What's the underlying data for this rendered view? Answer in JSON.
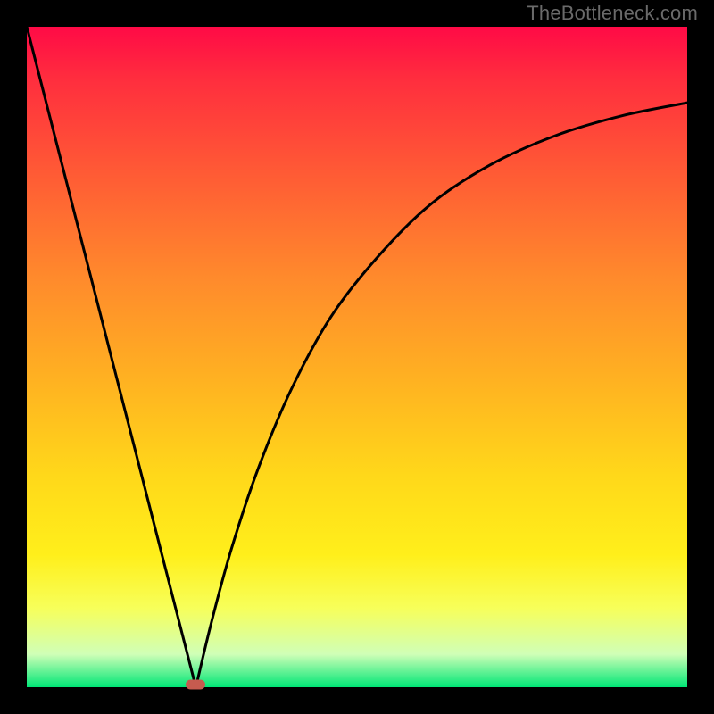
{
  "watermark": "TheBottleneck.com",
  "chart_data": {
    "type": "line",
    "title": "",
    "xlabel": "",
    "ylabel": "",
    "xlim": [
      0,
      100
    ],
    "ylim": [
      0,
      100
    ],
    "grid": false,
    "legend": false,
    "background_gradient": {
      "direction": "vertical",
      "stops": [
        {
          "pct": 0,
          "color": "#ff0a46"
        },
        {
          "pct": 22,
          "color": "#ff5a35"
        },
        {
          "pct": 54,
          "color": "#ffb321"
        },
        {
          "pct": 80,
          "color": "#ffef1b"
        },
        {
          "pct": 95,
          "color": "#d0ffb7"
        },
        {
          "pct": 100,
          "color": "#00e676"
        }
      ]
    },
    "series": [
      {
        "name": "left-slope",
        "x": [
          0,
          25.6
        ],
        "y": [
          100,
          0
        ],
        "stroke": "#000000"
      },
      {
        "name": "right-curve",
        "x": [
          25.6,
          28,
          31,
          35,
          40,
          46,
          53,
          61,
          70,
          80,
          90,
          100
        ],
        "y": [
          0,
          10,
          21,
          33,
          45,
          56,
          65,
          73,
          79,
          83.5,
          86.5,
          88.5
        ],
        "stroke": "#000000"
      }
    ],
    "marker": {
      "x": 25.6,
      "y": 0,
      "color": "#c65b4f",
      "shape": "pill"
    }
  }
}
